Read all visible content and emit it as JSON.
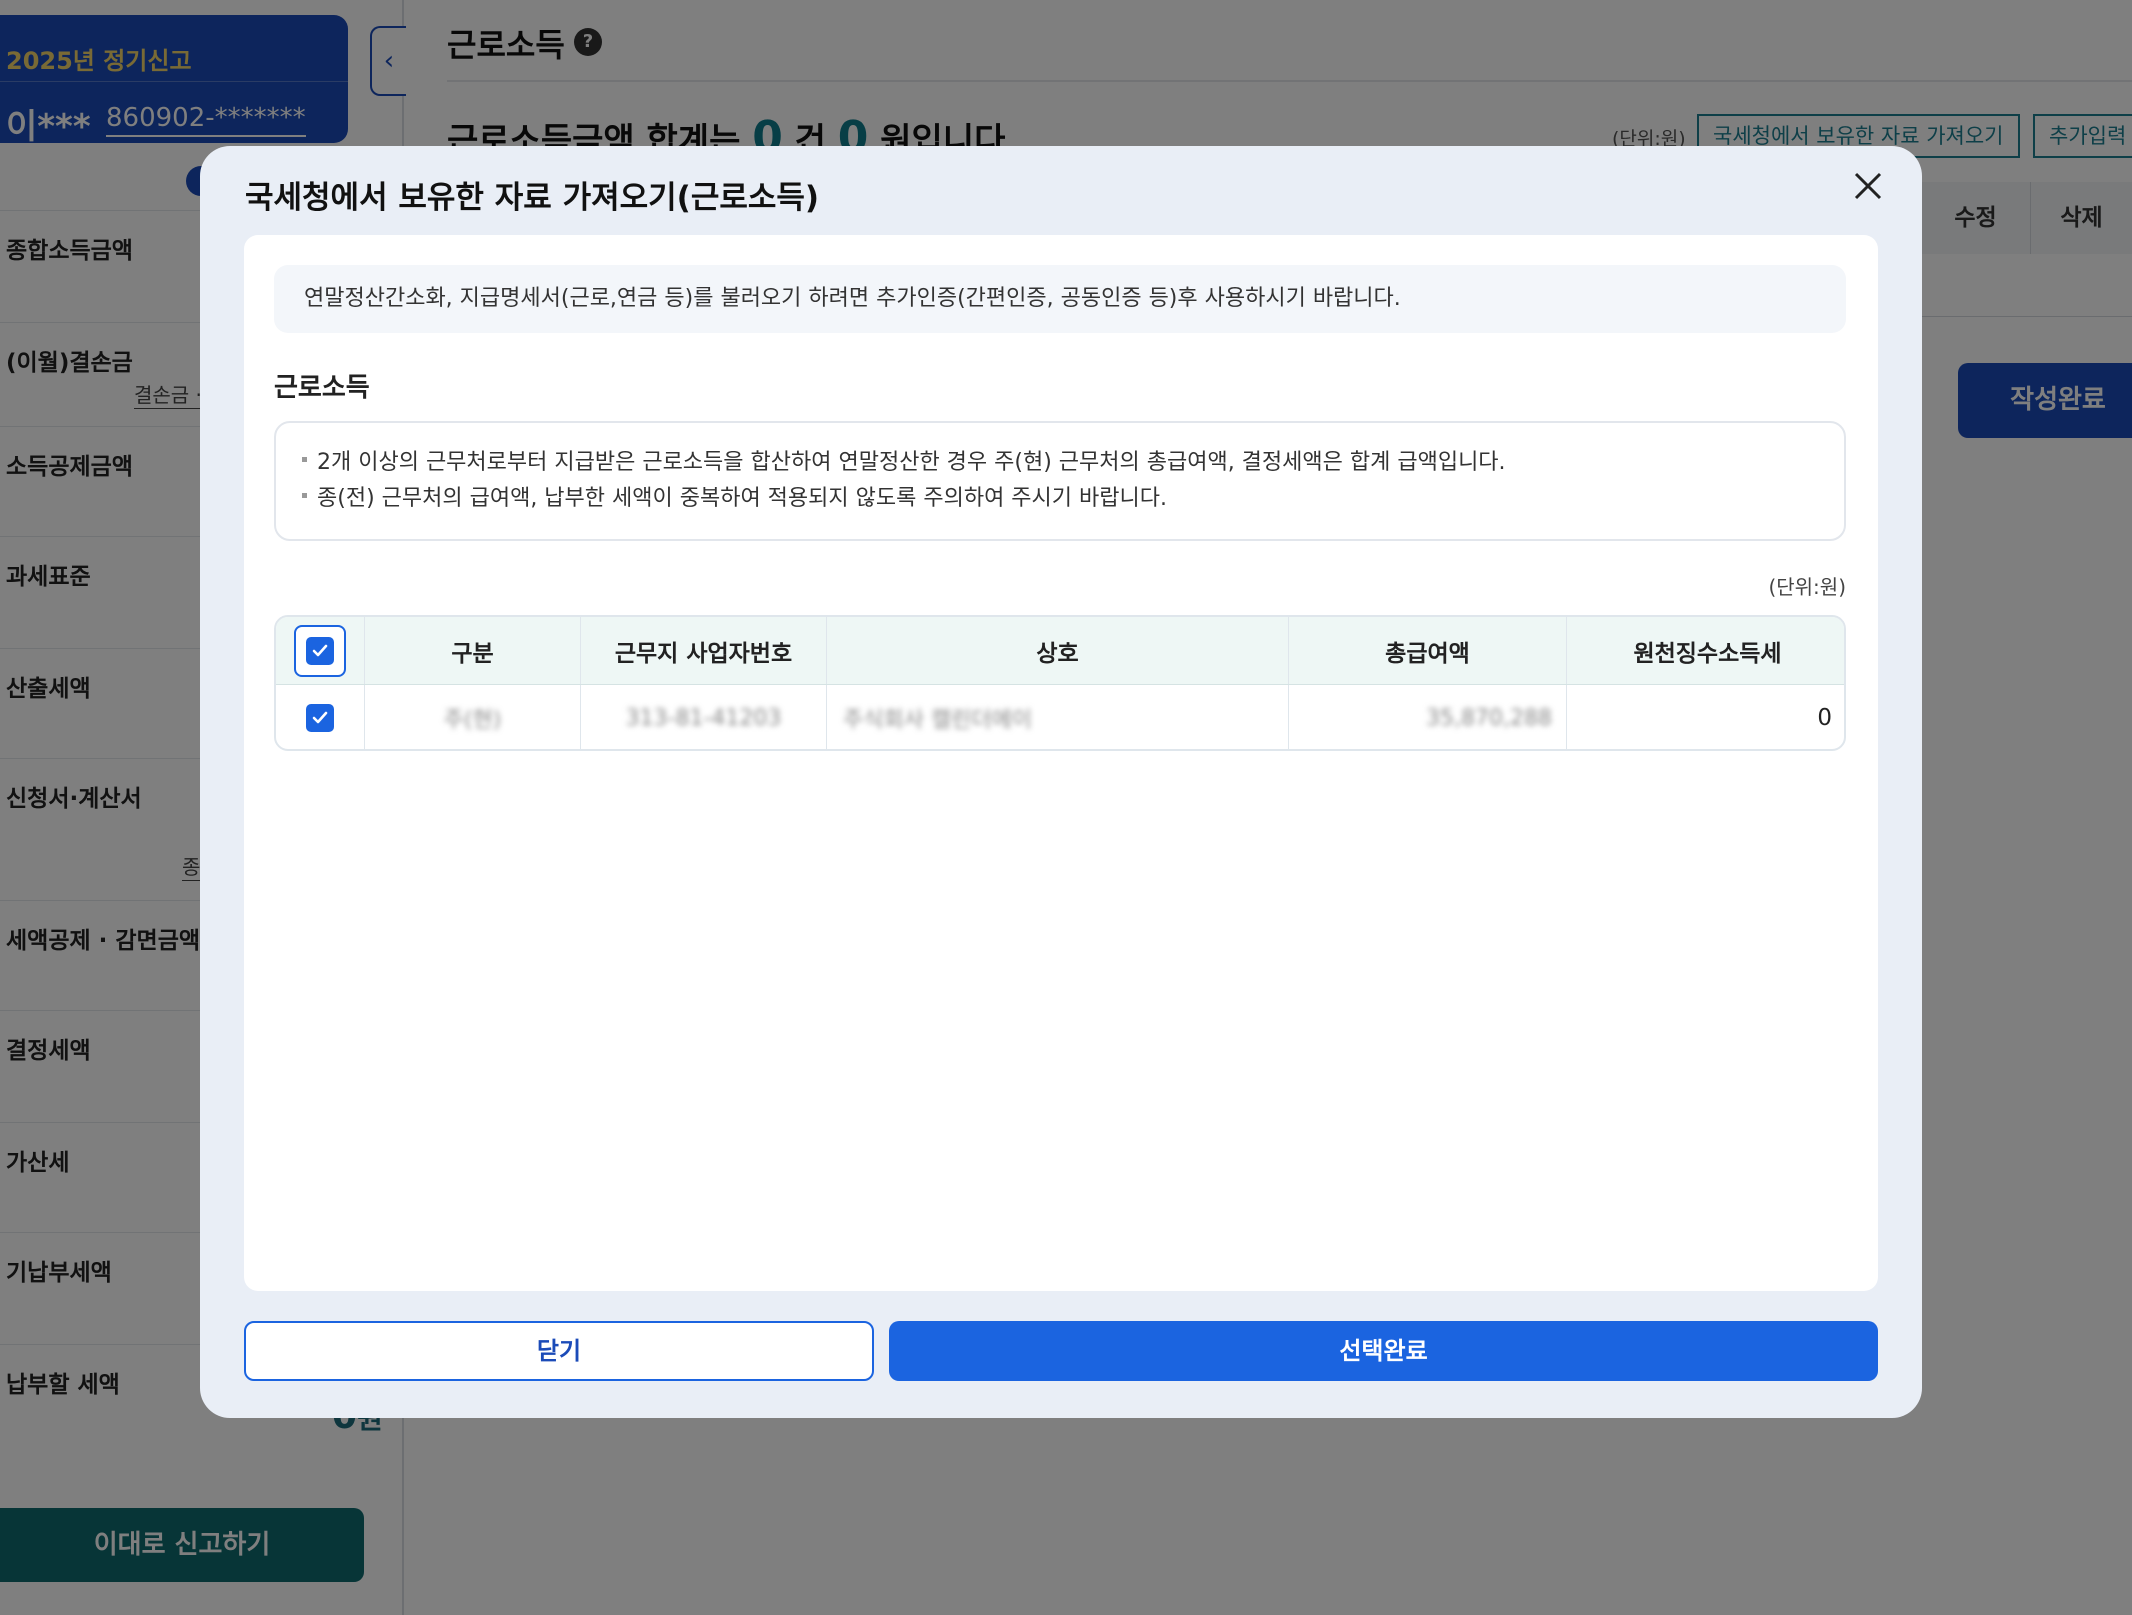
{
  "sidebar": {
    "filing_label": "2025년 정기신고",
    "user_name": "이***",
    "user_rrn": "860902-*******",
    "items": [
      {
        "label": "종합소득금액",
        "sub": ""
      },
      {
        "label": "(이월)결손금",
        "sub": "결손금 ·"
      },
      {
        "label": "소득공제금액",
        "sub": ""
      },
      {
        "label": "과세표준",
        "sub": ""
      },
      {
        "label": "산출세액",
        "sub": ""
      },
      {
        "label": "신청서·계산서",
        "sub": "종"
      },
      {
        "label": "세액공제 · 감면금액",
        "sub": ""
      },
      {
        "label": "결정세액",
        "sub": ""
      },
      {
        "label": "가산세",
        "sub": ""
      },
      {
        "label": "기납부세액",
        "sub": ""
      },
      {
        "label": "납부할 세액",
        "sub": ""
      }
    ],
    "total_value": "0",
    "total_unit": "원",
    "submit_label": "이대로 신고하기"
  },
  "main": {
    "title": "근로소득",
    "help_icon": "?",
    "summary_prefix": "근로소득금액 합계는",
    "summary_count": "0",
    "summary_count_unit": "건",
    "summary_amount": "0",
    "summary_suffix": "원입니다",
    "unit_label": "(단위:원)",
    "fetch_button": "국세청에서 보유한 자료 가져오기",
    "add_button": "추가입력",
    "col_edit": "수정",
    "col_delete": "삭제",
    "complete_button": "작성완료"
  },
  "modal": {
    "title": "국세청에서 보유한 자료 가져오기(근로소득)",
    "notice": "연말정산간소화, 지급명세서(근로,연금 등)를 불러오기 하려면 추가인증(간편인증, 공동인증 등)후 사용하시기 바랍니다.",
    "section_title": "근로소득",
    "info_lines": [
      "2개 이상의 근무처로부터 지급받은 근로소득을 합산하여 연말정산한 경우 주(현) 근무처의 총급여액, 결정세액은 합계 급액입니다.",
      "종(전) 근무처의 급여액, 납부한 세액이 중복하여 적용되지 않도록 주의하여 주시기 바랍니다."
    ],
    "unit_label": "(단위:원)",
    "table": {
      "headers": [
        "구분",
        "근무지 사업자번호",
        "상호",
        "총급여액",
        "원천징수소득세"
      ],
      "rows": [
        {
          "category": "주(현)",
          "business_no": "313-81-41203",
          "company": "주식회사 캘린더에이",
          "total_salary": "35,870,288",
          "withholding_tax": "0"
        }
      ]
    },
    "close_button": "닫기",
    "confirm_button": "선택완료"
  },
  "colors": {
    "primary": "#1b64e0",
    "navy": "#1b4bb8",
    "teal": "#0f6a6f"
  }
}
